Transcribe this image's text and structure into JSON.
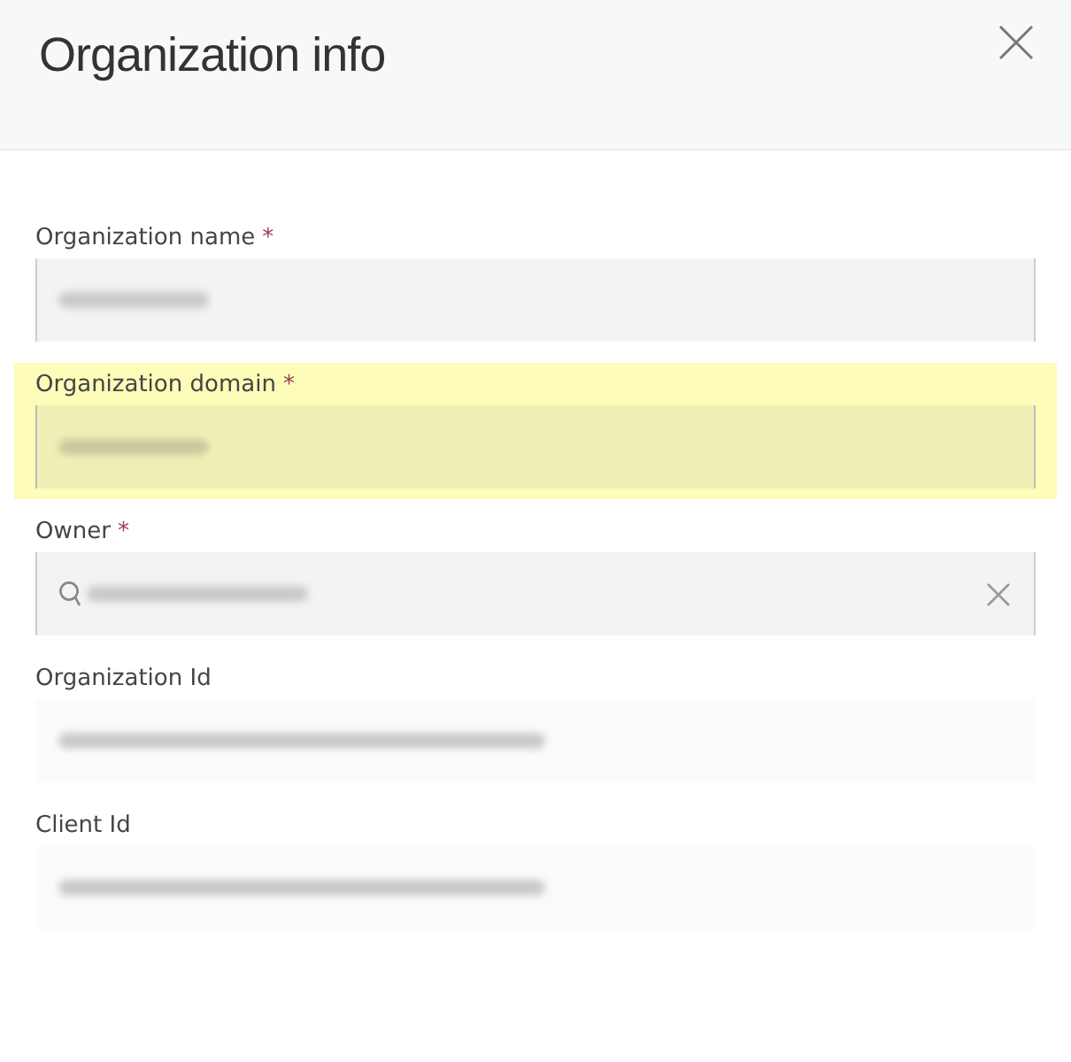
{
  "dialog": {
    "title": "Organization info"
  },
  "fields": [
    {
      "label": "Organization name",
      "required_mark": "*",
      "kind": "text",
      "highlighted": false,
      "redacted": true
    },
    {
      "label": "Organization domain",
      "required_mark": "*",
      "kind": "text",
      "highlighted": true,
      "redacted": true
    },
    {
      "label": "Owner",
      "required_mark": "*",
      "kind": "search",
      "highlighted": false,
      "redacted": true
    },
    {
      "label": "Organization Id",
      "kind": "identifier",
      "highlighted": false,
      "redacted": true
    },
    {
      "label": "Client Id",
      "kind": "identifier",
      "highlighted": false,
      "redacted": true
    }
  ]
}
